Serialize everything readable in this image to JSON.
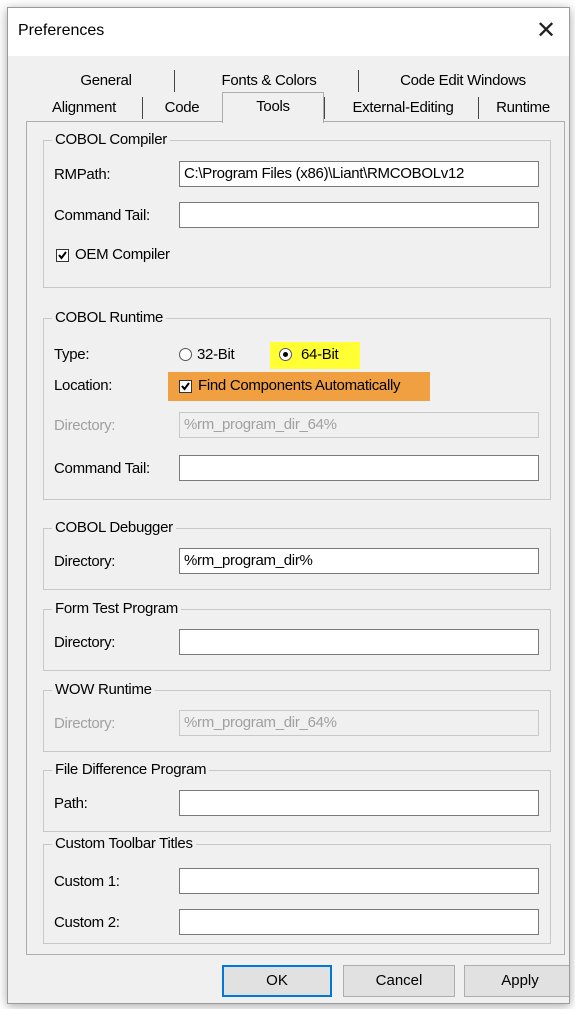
{
  "window": {
    "title": "Preferences",
    "close_glyph": "✕"
  },
  "tabs": {
    "row_back": [
      "General",
      "Fonts & Colors",
      "Code Edit Windows"
    ],
    "row_front": [
      "Alignment",
      "Code",
      "Tools",
      "External-Editing",
      "Runtime"
    ],
    "active": "Tools"
  },
  "cobol_compiler": {
    "title": "COBOL Compiler",
    "rmpath_label": "RMPath:",
    "rmpath_value": "C:\\Program Files (x86)\\Liant\\RMCOBOLv12",
    "command_tail_label": "Command Tail:",
    "command_tail_value": "",
    "oem_label": "OEM Compiler",
    "oem_checked": true
  },
  "cobol_runtime": {
    "title": "COBOL Runtime",
    "type_label": "Type:",
    "option_32": "32-Bit",
    "option_64": "64-Bit",
    "selected": "64-Bit",
    "location_label": "Location:",
    "find_label": "Find Components Automatically",
    "find_checked": true,
    "directory_label": "Directory:",
    "directory_value": "%rm_program_dir_64%",
    "command_tail_label": "Command Tail:",
    "command_tail_value": ""
  },
  "cobol_debugger": {
    "title": "COBOL Debugger",
    "directory_label": "Directory:",
    "directory_value": "%rm_program_dir%"
  },
  "form_test": {
    "title": "Form Test Program",
    "directory_label": "Directory:",
    "directory_value": ""
  },
  "wow_runtime": {
    "title": "WOW Runtime",
    "directory_label": "Directory:",
    "directory_value": "%rm_program_dir_64%"
  },
  "file_diff": {
    "title": "File Difference Program",
    "path_label": "Path:",
    "path_value": ""
  },
  "custom_toolbar": {
    "title": "Custom Toolbar Titles",
    "custom1_label": "Custom 1:",
    "custom1_value": "",
    "custom2_label": "Custom 2:",
    "custom2_value": ""
  },
  "buttons": {
    "ok": "OK",
    "cancel": "Cancel",
    "apply": "Apply"
  },
  "colors": {
    "highlight_64bit": "#ffff33",
    "highlight_find": "#f0a040",
    "default_button_border": "#0078d7"
  }
}
